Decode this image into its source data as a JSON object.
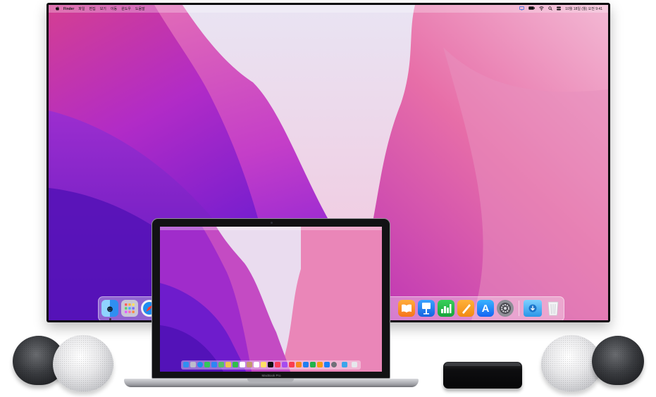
{
  "menubar": {
    "apple_icon": "apple-logo-icon",
    "app_name": "Finder",
    "menus": [
      "파일",
      "편집",
      "보기",
      "이동",
      "윈도우",
      "도움말"
    ],
    "datetime": "10월 18일 (월) 오전 9:41",
    "status_icons": [
      "screen-mirroring-icon",
      "battery-icon",
      "wifi-icon",
      "spotlight-icon",
      "control-center-icon"
    ]
  },
  "dock": {
    "apps": [
      {
        "name": "finder-icon",
        "color": "#2f8ff1",
        "glyph": "☻"
      },
      {
        "name": "launchpad-icon",
        "color": "#a9a6b8",
        "glyph": "▦"
      },
      {
        "name": "safari-icon",
        "color": "#1c8cf0",
        "glyph": "◎"
      },
      {
        "name": "books-icon",
        "color": "#f6891f",
        "glyph": "▥"
      },
      {
        "name": "keynote-icon",
        "color": "#1f7ff0",
        "glyph": "▮"
      },
      {
        "name": "numbers-icon",
        "color": "#21b34a",
        "glyph": "▆"
      },
      {
        "name": "pages-icon",
        "color": "#f59b17",
        "glyph": "✎"
      },
      {
        "name": "app-store-icon",
        "color": "#1a82f7",
        "glyph": "A"
      },
      {
        "name": "system-preferences-icon",
        "color": "#707078",
        "glyph": "⚙"
      },
      {
        "name": "downloads-folder-icon",
        "color": "#3ba6ea",
        "glyph": "⬇"
      },
      {
        "name": "trash-icon",
        "color": "#e6e8ec",
        "glyph": ""
      }
    ]
  },
  "laptop": {
    "label": "MacBook Pro"
  },
  "colors": {
    "wall_light": "#efe2f0",
    "wall_pink": "#e1468f",
    "wall_purple": "#7a1fd3",
    "wall_deep": "#5a17b8"
  }
}
